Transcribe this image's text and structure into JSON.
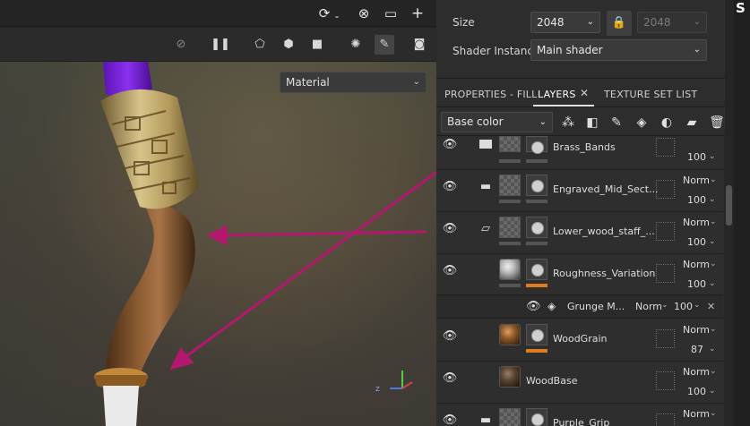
{
  "viewport": {
    "display_select": "Material"
  },
  "properties": {
    "size_label": "Size",
    "size_value": "2048",
    "size_linked_value": "2048",
    "shader_label": "Shader Instance",
    "shader_value": "Main shader"
  },
  "tabs": [
    {
      "label": "PROPERTIES - FILL"
    },
    {
      "label": "LAYERS"
    },
    {
      "label": "TEXTURE SET LIST"
    }
  ],
  "layer_tools": {
    "blend_channel": "Base color"
  },
  "layers": [
    {
      "name": "Brass_Bands",
      "blend": "",
      "opacity": "100"
    },
    {
      "name": "Engraved_Mid_Sect...",
      "blend": "Norm",
      "opacity": "100"
    },
    {
      "name": "Lower_wood_staff_...",
      "blend": "Norm",
      "opacity": "100"
    },
    {
      "name": "Roughness_Variation",
      "blend": "Norm",
      "opacity": "100"
    },
    {
      "name": "Grunge M...",
      "blend": "Norm",
      "opacity": "100"
    },
    {
      "name": "WoodGrain",
      "blend": "Norm",
      "opacity": "87"
    },
    {
      "name": "WoodBase",
      "blend": "Norm",
      "opacity": "100"
    },
    {
      "name": "Purple_Grip",
      "blend": "Norm",
      "opacity": ""
    }
  ],
  "colors": {
    "accent_orange": "#e07b1e",
    "annotation_arrow": "#b3186e"
  },
  "axis_gizmo": {
    "z": "Z"
  }
}
